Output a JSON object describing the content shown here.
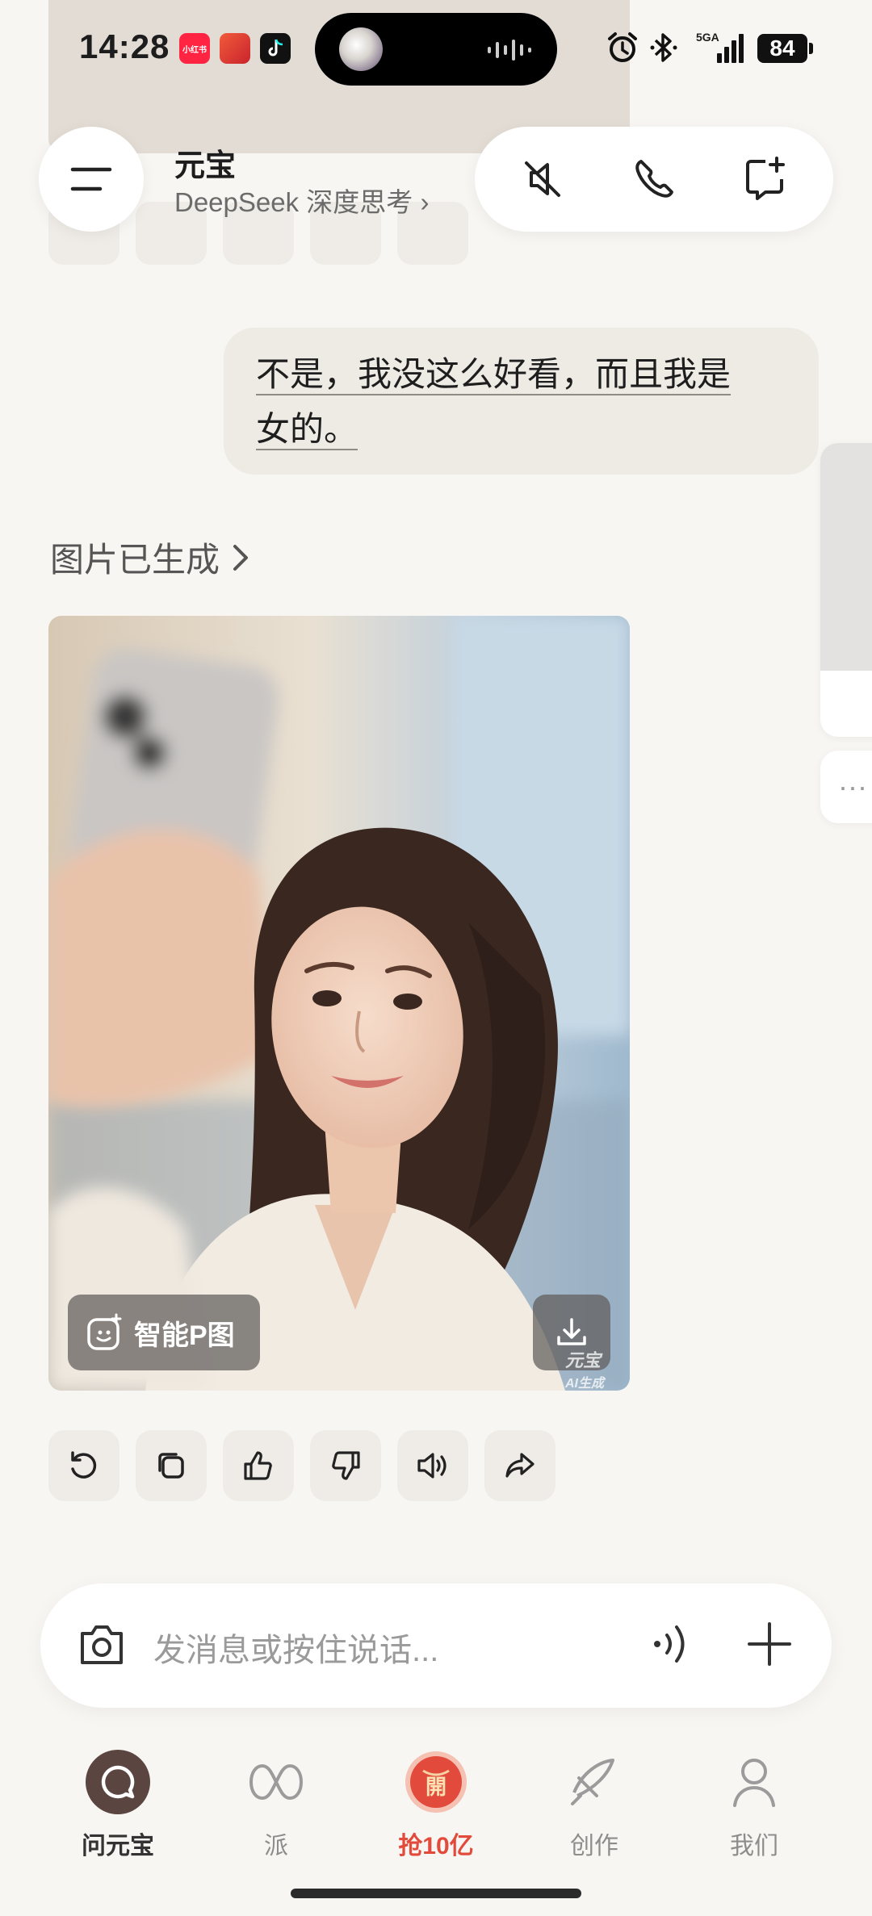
{
  "status_bar": {
    "time": "14:28",
    "network": "5GA",
    "battery": "84",
    "apps": [
      {
        "name": "xiaohongshu-app-icon",
        "label": "小红书",
        "color": "#ff2442"
      },
      {
        "name": "game-app-icon",
        "label": "",
        "color": "#e8442e"
      },
      {
        "name": "douyin-app-icon",
        "label": "",
        "color": "#111111"
      }
    ]
  },
  "header": {
    "title": "元宝",
    "subtitle": "DeepSeek 深度思考 ›"
  },
  "messages": {
    "user_line1": "不是，我没这么好看，而且我是",
    "user_line2": "女的。",
    "image_generated_label": "图片已生成"
  },
  "image_overlay": {
    "edit_label": "智能P图",
    "watermark_line1": "元宝",
    "watermark_line2": "AI生成"
  },
  "input": {
    "placeholder": "发消息或按住说话..."
  },
  "nav": {
    "items": [
      {
        "label": "问元宝"
      },
      {
        "label": "派"
      },
      {
        "label": "抢10亿",
        "badge": "開"
      },
      {
        "label": "创作"
      },
      {
        "label": "我们"
      }
    ]
  },
  "colors": {
    "background": "#f8f6f2",
    "accent_red": "#e24a3b",
    "active_nav": "#5b4541"
  }
}
